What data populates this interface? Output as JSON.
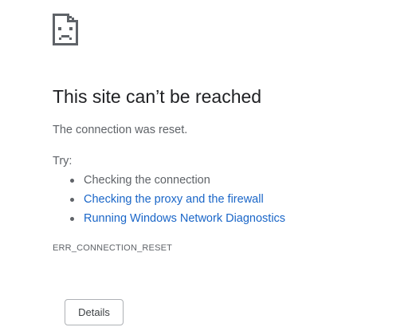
{
  "icon": "sad-page-icon",
  "heading": "This site can’t be reached",
  "message": "The connection was reset.",
  "try_label": "Try:",
  "suggestions": [
    {
      "text": "Checking the connection",
      "is_link": false
    },
    {
      "text": "Checking the proxy and the firewall",
      "is_link": true
    },
    {
      "text": "Running Windows Network Diagnostics",
      "is_link": true
    }
  ],
  "error_code": "ERR_CONNECTION_RESET",
  "details_button": "Details",
  "colors": {
    "heading": "#202124",
    "body_text": "#5f6368",
    "link": "#1a66c8",
    "button_border": "#aeb1b5"
  }
}
